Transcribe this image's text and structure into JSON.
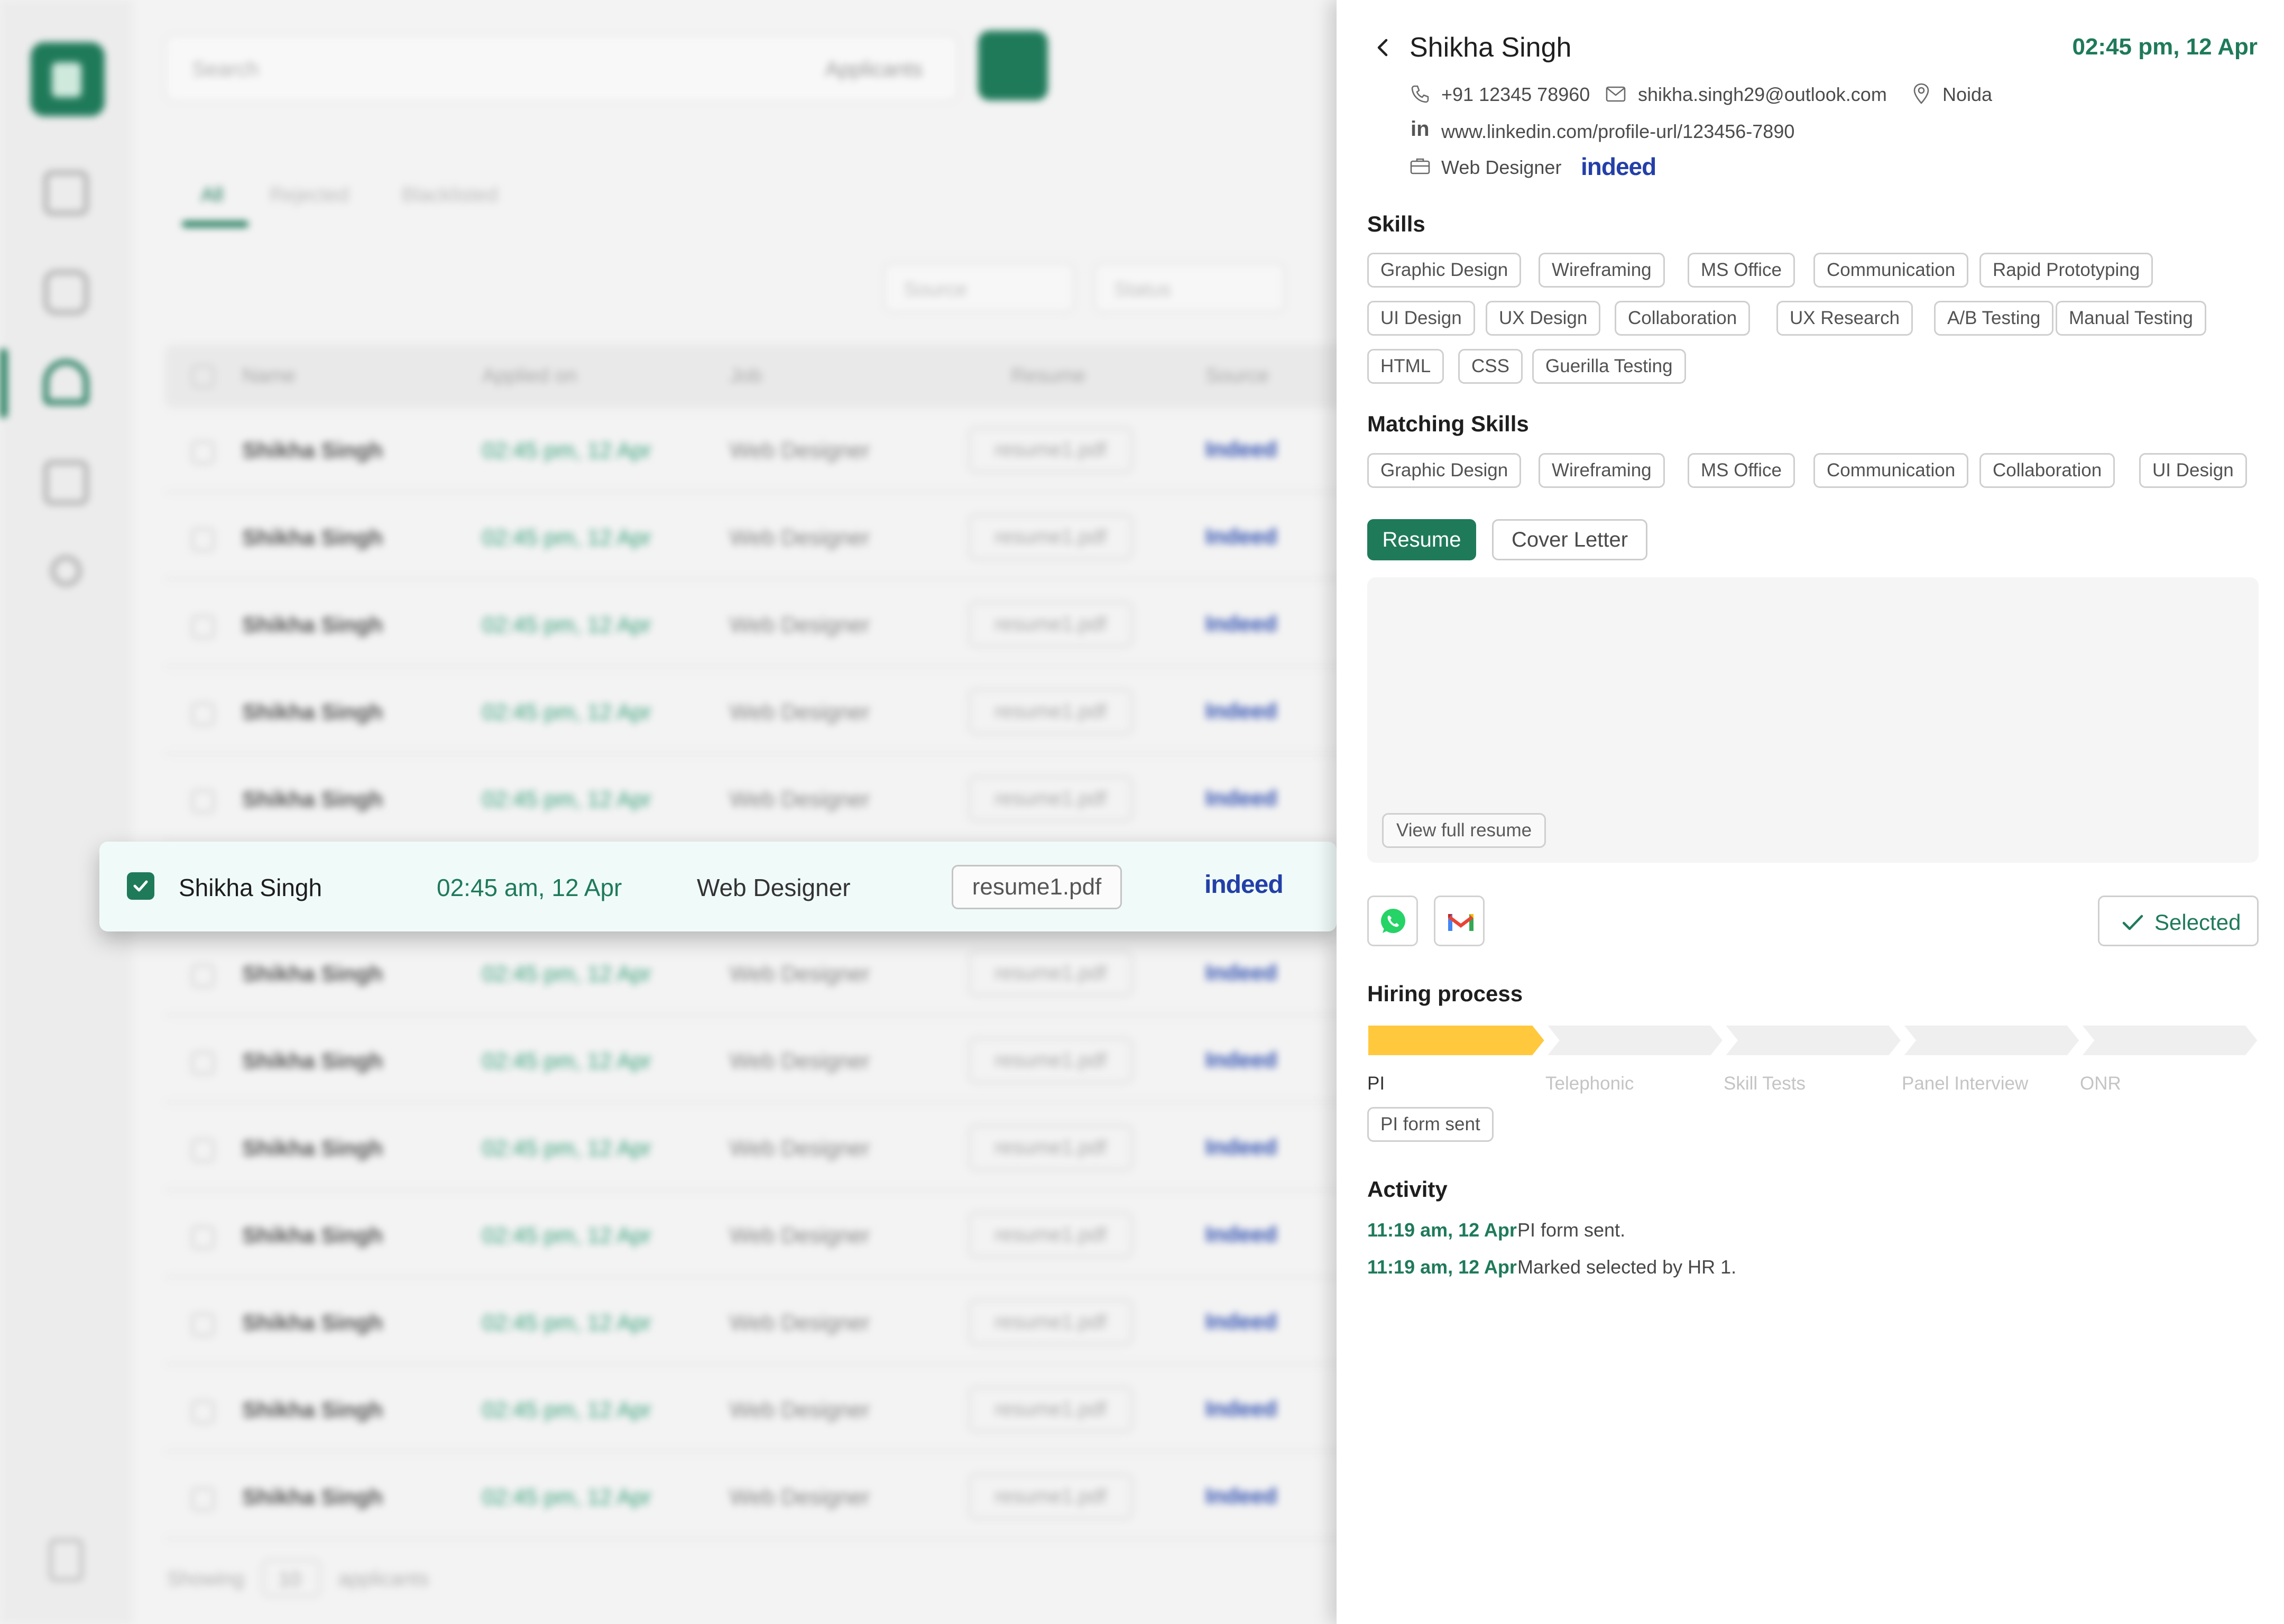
{
  "background": {
    "search": {
      "placeholder": "Search",
      "scope": "Applicants"
    },
    "tabs": [
      "All",
      "Rejected",
      "Blacklisted"
    ],
    "filters": [
      "Source",
      "Status"
    ],
    "columns": [
      "Name",
      "Applied on",
      "Job",
      "Resume",
      "Source"
    ],
    "row": {
      "name": "Shikha Singh",
      "date": "02:45 pm, 12 Apr",
      "job": "Web Designer",
      "resume": "resume1.pdf",
      "source": "Indeed"
    },
    "footer": {
      "showing": "Showing",
      "count": "10",
      "suffix": "applicants"
    }
  },
  "selected_row": {
    "name": "Shikha Singh",
    "date": "02:45 am, 12 Apr",
    "job": "Web Designer",
    "resume": "resume1.pdf",
    "source": "indeed",
    "checked": true
  },
  "panel": {
    "name": "Shikha Singh",
    "time": "02:45 pm, 12 Apr",
    "phone": "+91 12345 78960",
    "email": "shikha.singh29@outlook.com",
    "location": "Noida",
    "linkedin": "www.linkedin.com/profile-url/123456-7890",
    "job": "Web Designer",
    "source": "indeed",
    "skills_title": "Skills",
    "skills": [
      "Graphic Design",
      "Wireframing",
      "MS Office",
      "Communication",
      "Rapid Prototyping",
      "UI Design",
      "UX Design",
      "Collaboration",
      "UX Research",
      "A/B Testing",
      "Manual Testing",
      "HTML",
      "CSS",
      "Guerilla Testing"
    ],
    "matching_title": "Matching Skills",
    "matching_skills": [
      "Graphic Design",
      "Wireframing",
      "MS Office",
      "Communication",
      "Collaboration",
      "UI Design"
    ],
    "doc_tabs": {
      "resume": "Resume",
      "cover": "Cover Letter"
    },
    "view_full": "View full resume",
    "selected_label": "Selected",
    "hiring_title": "Hiring process",
    "stages": [
      "PI",
      "Telephonic",
      "Skill Tests",
      "Panel Interview",
      "ONR"
    ],
    "current_stage_index": 0,
    "stage_status": "PI form sent",
    "activity_title": "Activity",
    "activity": [
      {
        "time": "11:19 am, 12 Apr",
        "text": "PI form sent."
      },
      {
        "time": "11:19 am, 12 Apr",
        "text": "Marked selected by HR 1."
      }
    ]
  },
  "colors": {
    "accent": "#1f7a5a",
    "stage_active": "#ffc83d",
    "stage_inactive": "#efefef",
    "indeed": "#233fa8"
  },
  "icons": [
    "chevron-left-icon",
    "phone-icon",
    "mail-icon",
    "location-pin-icon",
    "linkedin-icon",
    "briefcase-icon",
    "whatsapp-icon",
    "gmail-icon",
    "checkmark-icon"
  ]
}
